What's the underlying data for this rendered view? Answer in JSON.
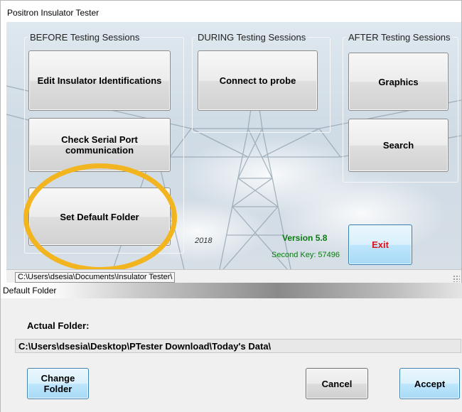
{
  "main_window": {
    "title": "Positron Insulator Tester",
    "groups": {
      "before": {
        "legend": "BEFORE Testing Sessions",
        "buttons": {
          "edit": "Edit Insulator Identifications",
          "check_serial": "Check Serial Port communication",
          "set_default_folder": "Set Default Folder"
        }
      },
      "during": {
        "legend": "DURING Testing Sessions",
        "buttons": {
          "connect": "Connect to probe"
        }
      },
      "after": {
        "legend": "AFTER Testing Sessions",
        "buttons": {
          "graphics": "Graphics",
          "search": "Search"
        }
      }
    },
    "year": "2018",
    "version": "Version 5.8",
    "second_key": "Second Key: 57496",
    "exit_label": "Exit",
    "status_path": "C:\\Users\\dsesia\\Documents\\Insulator Tester\\",
    "highlight_color": "#f2b51f",
    "version_color": "#0a7b12",
    "exit_color": "#d8141a"
  },
  "dialog": {
    "title": "Default Folder",
    "actual_folder_label": "Actual Folder:",
    "actual_folder_path": "C:\\Users\\dsesia\\Desktop\\PTester Download\\Today's Data\\",
    "buttons": {
      "change_folder": "Change Folder",
      "cancel": "Cancel",
      "accept": "Accept"
    }
  }
}
